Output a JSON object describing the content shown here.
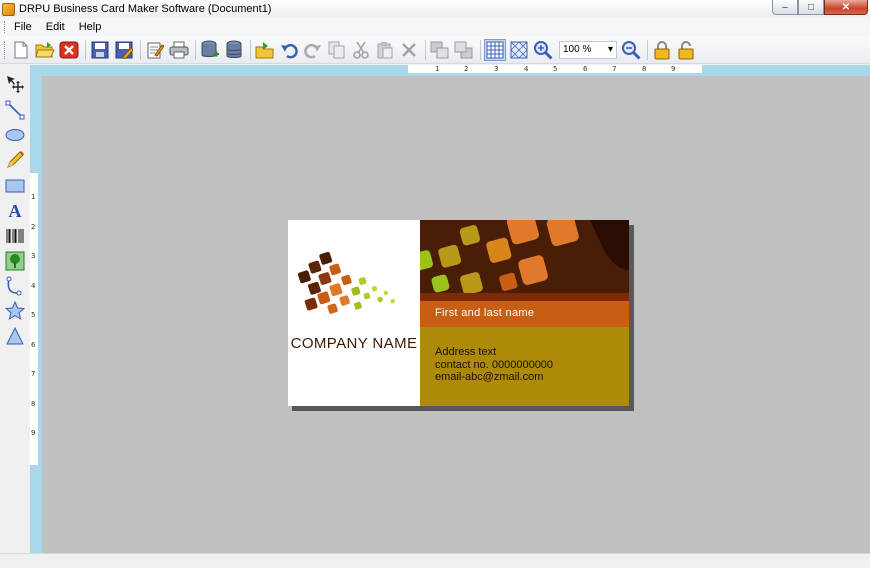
{
  "window": {
    "title": "DRPU Business Card Maker Software  (Document1)",
    "controls": {
      "minimize": "–",
      "maximize": "□",
      "close": "✕"
    }
  },
  "menu": {
    "items": [
      "File",
      "Edit",
      "Help"
    ]
  },
  "toolbar": {
    "zoom_value": "100 %",
    "zoom_arrow": "▾",
    "icons": [
      "new-icon",
      "open-icon",
      "close-icon",
      "save-icon",
      "save-as-icon",
      "properties-icon",
      "print-icon",
      "database-add-icon",
      "database-icon",
      "export-icon",
      "undo-icon",
      "redo-icon",
      "copy-icon",
      "cut-icon",
      "paste-icon",
      "delete-icon",
      "bring-front-icon",
      "send-back-icon",
      "grid-icon",
      "grid-alt-icon",
      "zoom-in-icon",
      "zoom-out-icon",
      "lock-icon",
      "unlock-icon"
    ]
  },
  "tools": {
    "icons": [
      "select-icon",
      "line-icon",
      "ellipse-icon",
      "pencil-icon",
      "rectangle-icon",
      "text-icon",
      "barcode-icon",
      "image-icon",
      "curve-icon",
      "star-icon",
      "triangle-icon"
    ],
    "text_glyph": "A"
  },
  "ruler": {
    "h_numbers": [
      "1",
      "2",
      "3",
      "4",
      "5",
      "6",
      "7",
      "8",
      "9"
    ],
    "v_numbers": [
      "1",
      "2",
      "3",
      "4",
      "5",
      "6",
      "7",
      "8",
      "9"
    ]
  },
  "card": {
    "company_name": "COMPANY  NAME",
    "person_name": "First  and  last  name",
    "address": "Address  text",
    "contact": "contact  no.  0000000000",
    "email": "email-abc@zmail.com",
    "colors": {
      "top": "#4a1d06",
      "name_bar": "#c85d14",
      "body": "#ad8a07",
      "square_orange": "#e07a2a",
      "square_green": "#9cc21c"
    }
  }
}
